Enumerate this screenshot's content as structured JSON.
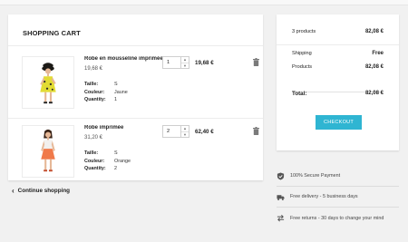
{
  "cart": {
    "title": "SHOPPING CART",
    "items": [
      {
        "name": "Robe en mousseline imprimée",
        "unit_price": "19,68 €",
        "attributes": [
          {
            "label": "Taille:",
            "value": "S"
          },
          {
            "label": "Couleur:",
            "value": "Jaune"
          },
          {
            "label": "Quantity:",
            "value": "1"
          }
        ],
        "quantity": "1",
        "total": "19,68 €",
        "image": "yellow-dress-model"
      },
      {
        "name": "Robe imprimée",
        "unit_price": "31,20 €",
        "attributes": [
          {
            "label": "Taille:",
            "value": "S"
          },
          {
            "label": "Couleur:",
            "value": "Orange"
          },
          {
            "label": "Quantity:",
            "value": "2"
          }
        ],
        "quantity": "2",
        "total": "62,40 €",
        "image": "orange-dress-model"
      }
    ],
    "continue_label": "Continue shopping"
  },
  "summary": {
    "products_count": "3 products",
    "products_count_value": "82,08 €",
    "shipping_label": "Shipping",
    "shipping_value": "Free",
    "products_label": "Products",
    "products_value": "82,08 €",
    "total_label": "Total:",
    "total_value": "82,08 €",
    "checkout_label": "CHECKOUT"
  },
  "reassurance": [
    {
      "icon": "shield-check-icon",
      "text": "100% Secure Payment"
    },
    {
      "icon": "truck-icon",
      "text": "Free delivery - 5 business days"
    },
    {
      "icon": "exchange-arrows-icon",
      "text": "Free returns - 30 days to change your mind"
    }
  ],
  "colors": {
    "accent": "#2fb5d2",
    "background": "#f1f1f1",
    "text": "#232323"
  }
}
